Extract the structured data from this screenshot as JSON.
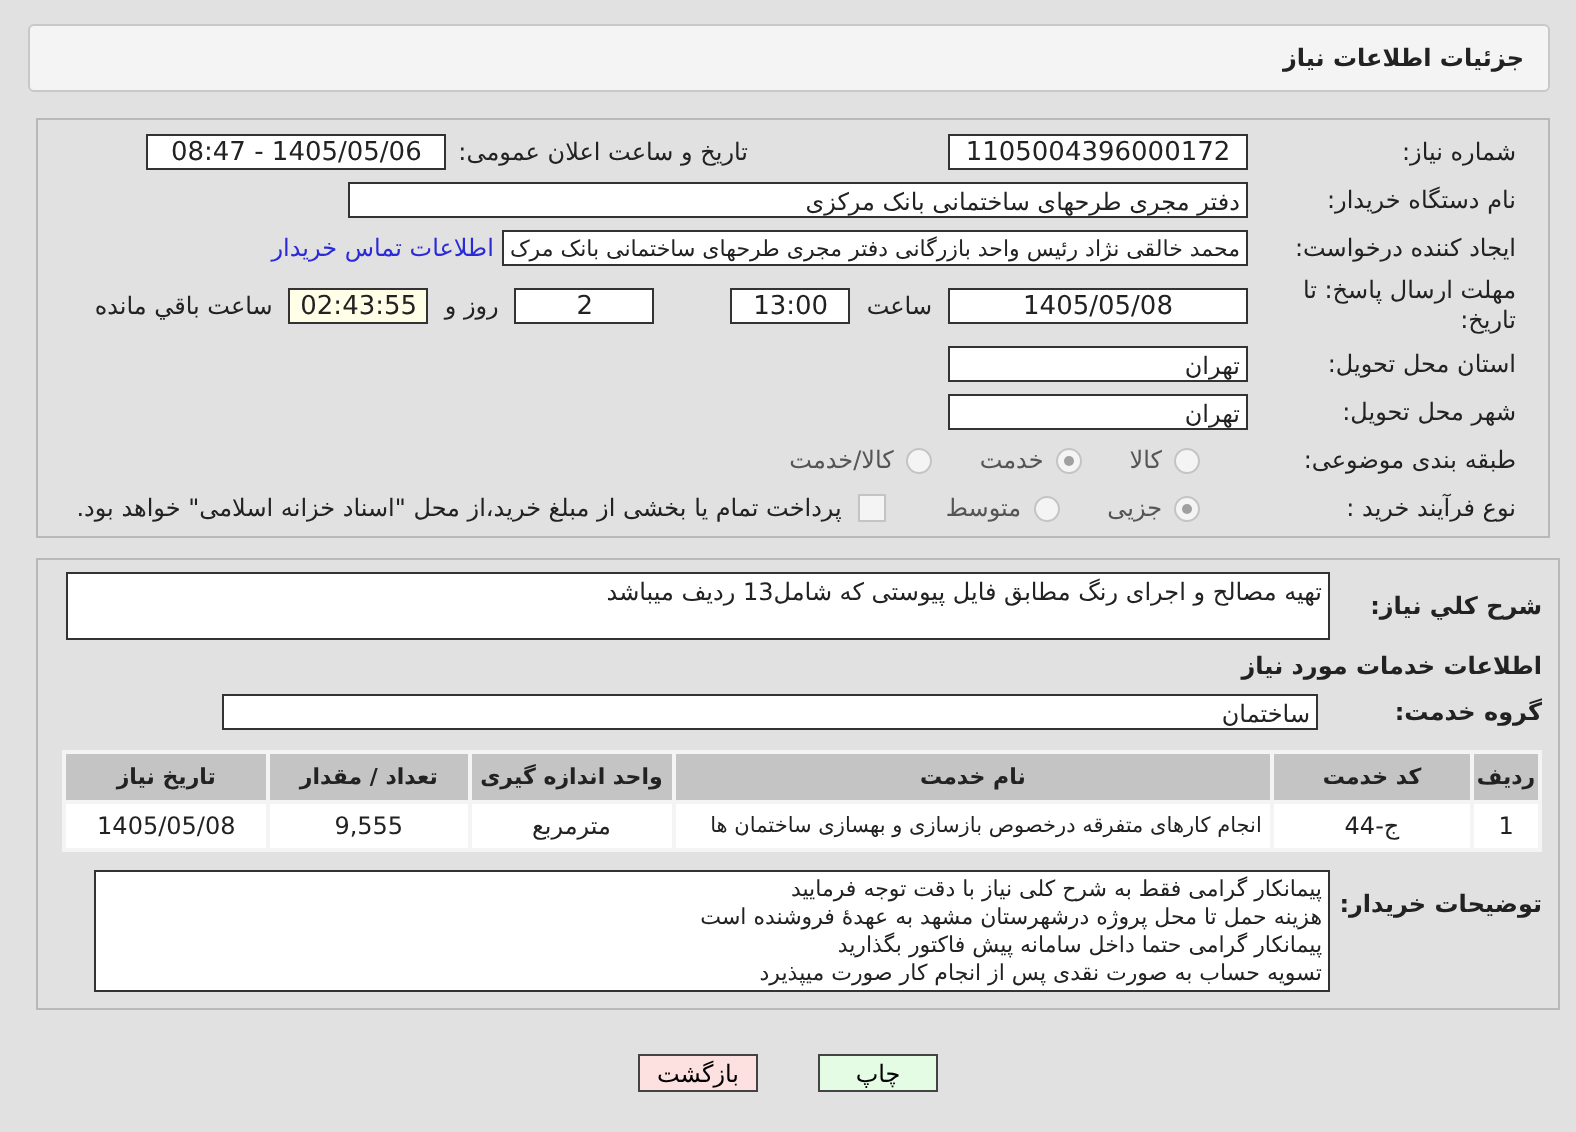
{
  "header": {
    "title": "جزئیات اطلاعات نیاز"
  },
  "need_number": {
    "label": "شماره نیاز:",
    "value": "1105004396000172"
  },
  "announce": {
    "label": "تاریخ و ساعت اعلان عمومی:",
    "value": "1405/05/06 - 08:47"
  },
  "buyer_org": {
    "label": "نام دستگاه خریدار:",
    "value": "دفتر مجری طرحهای ساختمانی بانک مرکزی"
  },
  "creator": {
    "label": "ایجاد کننده درخواست:",
    "value": "محمد خالقی نژاد رئیس واحد بازرگانی دفتر مجری طرحهای ساختمانی بانک مرک",
    "link": "اطلاعات تماس خریدار"
  },
  "deadline": {
    "label": "مهلت ارسال پاسخ: تا تاریخ:",
    "date": "1405/05/08",
    "time_label": "ساعت",
    "time": "13:00",
    "days": "2",
    "days_label": "روز و",
    "remaining": "02:43:55",
    "remaining_label": "ساعت باقي مانده"
  },
  "province": {
    "label": "استان محل تحویل:",
    "value": "تهران"
  },
  "city": {
    "label": "شهر محل تحویل:",
    "value": "تهران"
  },
  "category": {
    "label": "طبقه بندی موضوعی:",
    "options": [
      {
        "label": "کالا",
        "selected": false
      },
      {
        "label": "خدمت",
        "selected": true
      },
      {
        "label": "کالا/خدمت",
        "selected": false
      }
    ]
  },
  "process": {
    "label": "نوع فرآیند خرید :",
    "options": [
      {
        "label": "جزیی",
        "selected": true
      },
      {
        "label": "متوسط",
        "selected": false
      }
    ],
    "treasury": {
      "checked": false,
      "text": "پرداخت تمام یا بخشی از مبلغ خرید،از محل \"اسناد خزانه اسلامی\" خواهد بود."
    }
  },
  "description": {
    "label": "شرح کلي نیاز:",
    "value": "تهیه مصالح و اجرای رنگ مطابق فایل پیوستی که شامل13 ردیف میباشد"
  },
  "services_title": "اطلاعات خدمات مورد نیاز",
  "service_group": {
    "label": "گروه خدمت:",
    "value": "ساختمان"
  },
  "table": {
    "columns": [
      "ردیف",
      "کد خدمت",
      "نام خدمت",
      "واحد اندازه گیری",
      "تعداد / مقدار",
      "تاریخ نیاز"
    ],
    "rows": [
      [
        "1",
        "ج-44",
        "انجام کارهای متفرقه درخصوص بازسازی و بهسازی ساختمان ها",
        "مترمربع",
        "9,555",
        "1405/05/08"
      ]
    ]
  },
  "buyer_notes": {
    "label": "توضیحات خریدار:",
    "lines": [
      "پیمانکار گرامی فقط به شرح کلی نیاز با دقت توجه فرمایید",
      "هزینه حمل تا محل پروژه درشهرستان مشهد به عهدهٔ فروشنده است",
      "پیمانکار گرامی حتما داخل سامانه پیش فاکتور بگذارید",
      "تسویه حساب به صورت نقدی پس از  انجام  کار صورت میپذیرد"
    ]
  },
  "buttons": [
    {
      "label": "چاپ",
      "kind": "print"
    },
    {
      "label": "بازگشت",
      "kind": "back"
    }
  ]
}
